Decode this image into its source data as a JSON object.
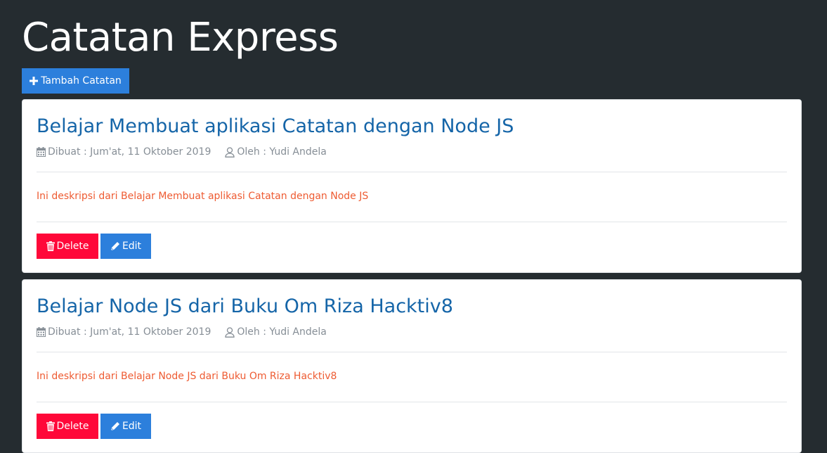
{
  "header": {
    "title": "Catatan Express",
    "add_label": "Tambah Catatan",
    "add_icon": "plus-icon"
  },
  "notes": [
    {
      "title": "Belajar Membuat aplikasi Catatan dengan Node JS",
      "created": "Dibuat : Jum'at, 11 Oktober 2019",
      "author": "Oleh : Yudi Andela",
      "description": "Ini deskripsi dari Belajar Membuat aplikasi Catatan dengan Node JS",
      "delete_label": "Delete",
      "edit_label": "Edit"
    },
    {
      "title": "Belajar Node JS dari Buku Om Riza Hacktiv8",
      "created": "Dibuat : Jum'at, 11 Oktober 2019",
      "author": "Oleh : Yudi Andela",
      "description": "Ini deskripsi dari Belajar Node JS dari Buku Om Riza Hacktiv8",
      "delete_label": "Delete",
      "edit_label": "Edit"
    }
  ],
  "icons": {
    "created": "calendar-icon",
    "author": "user-icon",
    "delete": "trash-icon",
    "edit": "pencil-icon"
  },
  "colors": {
    "background": "#252c30",
    "primary": "#2c7fdc",
    "danger": "#ff0839",
    "title": "#1565a8",
    "description": "#ee5b32",
    "muted": "#868e96"
  }
}
